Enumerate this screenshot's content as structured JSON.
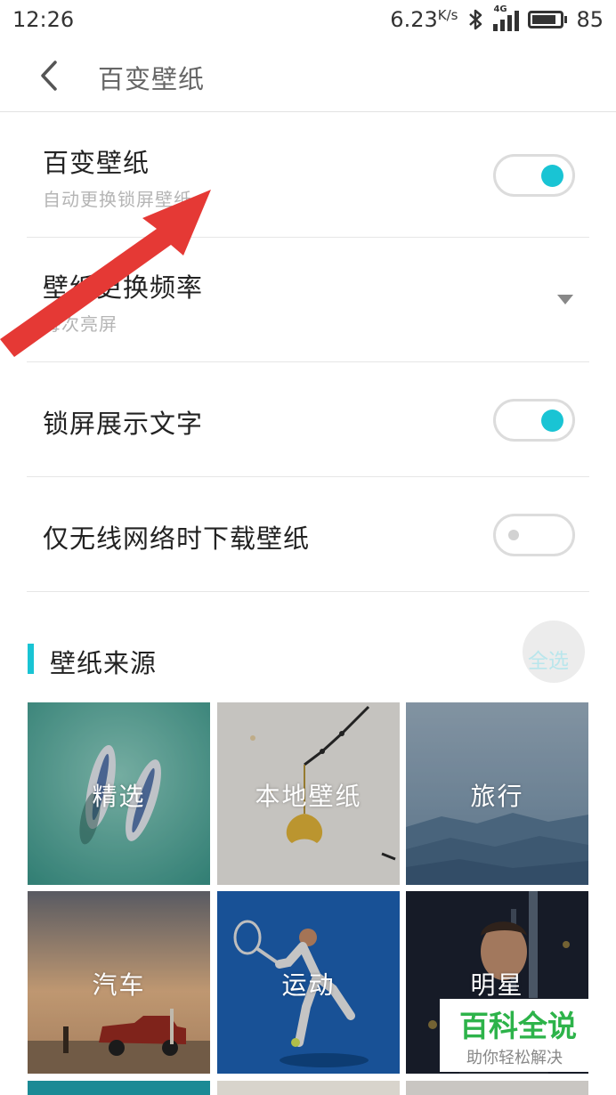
{
  "status_bar": {
    "time": "12:26",
    "net_speed": "6.23",
    "net_speed_unit": "K/s",
    "signal_label": "4G",
    "battery": "85"
  },
  "app_bar": {
    "title": "百变壁纸"
  },
  "settings": [
    {
      "title": "百变壁纸",
      "subtitle": "自动更换锁屏壁纸",
      "control": "toggle",
      "on": true
    },
    {
      "title": "壁纸更换频率",
      "subtitle": "每次亮屏",
      "control": "dropdown"
    },
    {
      "title": "锁屏展示文字",
      "control": "toggle",
      "on": true
    },
    {
      "title": "仅无线网络时下载壁纸",
      "control": "toggle",
      "on": false
    }
  ],
  "section": {
    "title": "壁纸来源",
    "select_all": "全选"
  },
  "wallpaper_sources": [
    {
      "label": "精选"
    },
    {
      "label": "本地壁纸"
    },
    {
      "label": "旅行"
    },
    {
      "label": "汽车"
    },
    {
      "label": "运动"
    },
    {
      "label": "明星"
    }
  ],
  "watermark": {
    "main": "百科全说",
    "sub": "助你轻松解决"
  },
  "colors": {
    "accent": "#19c4d4",
    "arrow": "#e53935",
    "watermark_green": "#2db34a"
  }
}
